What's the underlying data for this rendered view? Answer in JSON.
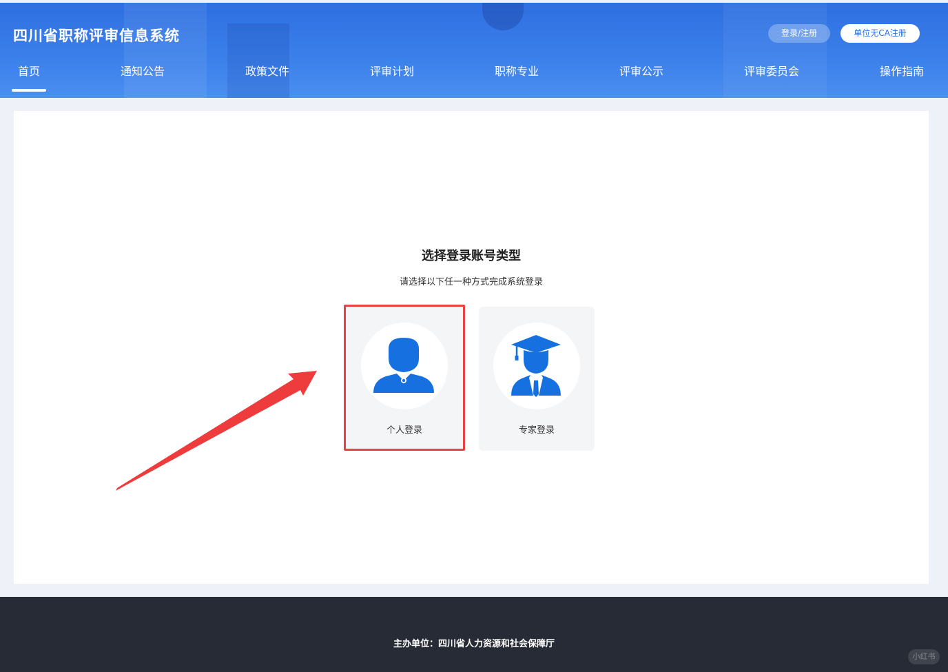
{
  "header": {
    "site_title": "四川省职称评审信息系统",
    "login_register": "登录/注册",
    "unit_no_ca_register": "单位无CA注册"
  },
  "nav": {
    "items": [
      {
        "label": "首页",
        "active": true
      },
      {
        "label": "通知公告"
      },
      {
        "label": "政策文件"
      },
      {
        "label": "评审计划"
      },
      {
        "label": "职称专业"
      },
      {
        "label": "评审公示"
      },
      {
        "label": "评审委员会"
      },
      {
        "label": "操作指南"
      }
    ]
  },
  "main": {
    "heading": "选择登录账号类型",
    "subheading": "请选择以下任一种方式完成系统登录",
    "cards": [
      {
        "label": "个人登录",
        "icon": "person-icon",
        "highlighted": true
      },
      {
        "label": "专家登录",
        "icon": "graduate-icon"
      }
    ]
  },
  "footer": {
    "sponsor": "主办单位：四川省人力资源和社会保障厅",
    "watermark": "小红书"
  },
  "colors": {
    "header_blue": "#2f6fe0",
    "icon_blue": "#1670e0",
    "highlight_red": "#e8413f",
    "footer_dark": "#262b35"
  }
}
